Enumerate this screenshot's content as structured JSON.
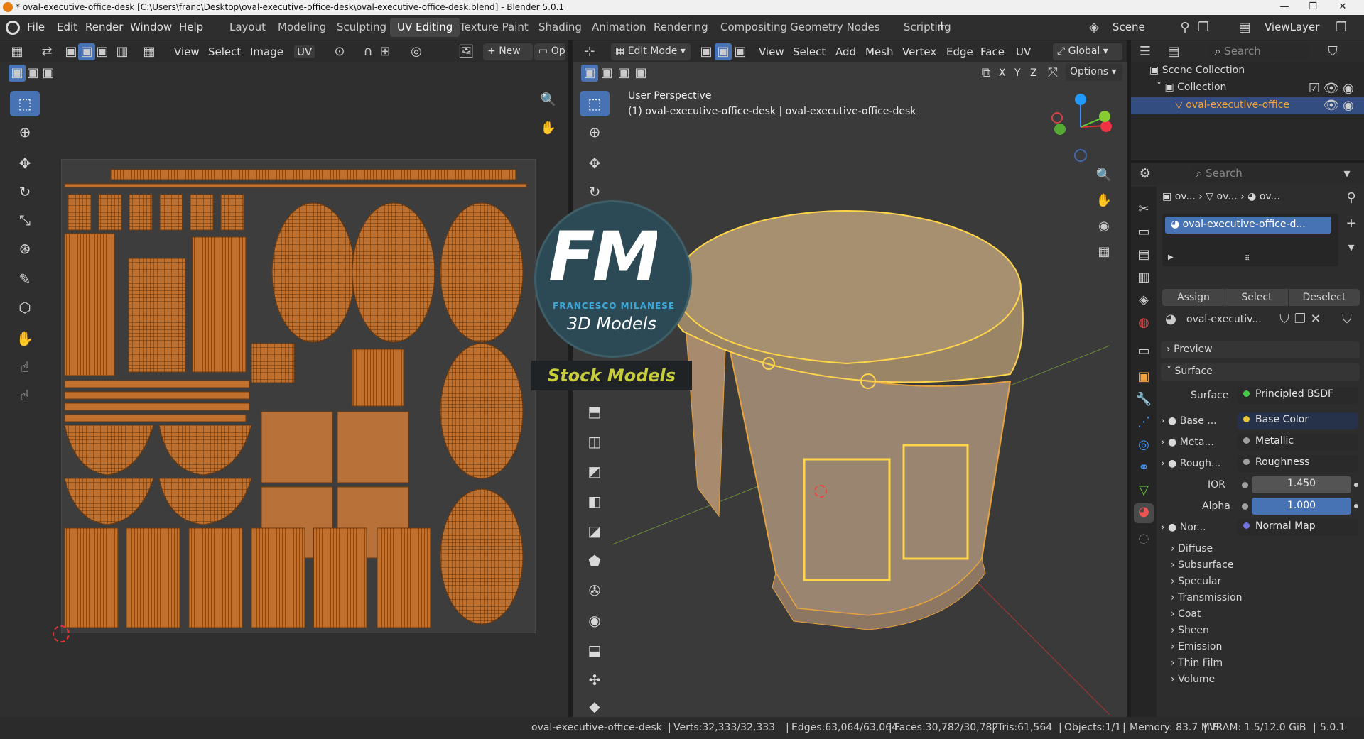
{
  "titlebar": {
    "title": "* oval-executive-office-desk [C:\\Users\\franc\\Desktop\\oval-executive-office-desk\\oval-executive-office-desk.blend] - Blender 5.0.1",
    "minimize": "—",
    "maximize": "❐",
    "close": "✕"
  },
  "menu": {
    "file": "File",
    "edit": "Edit",
    "render": "Render",
    "window": "Window",
    "help": "Help"
  },
  "workspaces": [
    "Layout",
    "Modeling",
    "Sculpting",
    "UV Editing",
    "Texture Paint",
    "Shading",
    "Animation",
    "Rendering",
    "Compositing",
    "Geometry Nodes",
    "Scripting"
  ],
  "workspace_add": "+",
  "scene": {
    "label": "Scene",
    "view_layer": "ViewLayer"
  },
  "uv_editor": {
    "view": "View",
    "select": "Select",
    "image": "Image",
    "uv": "UV",
    "new": "New",
    "open": "Op"
  },
  "viewport": {
    "mode": "Edit Mode",
    "view": "View",
    "select": "Select",
    "add": "Add",
    "mesh": "Mesh",
    "vertex": "Vertex",
    "edge": "Edge",
    "face": "Face",
    "uv": "UV",
    "orientation": "Global",
    "options": "Options",
    "x": "X",
    "y": "Y",
    "z": "Z",
    "perspective": "User Perspective",
    "object_info": "(1) oval-executive-office-desk | oval-executive-office-desk"
  },
  "watermark": {
    "logo": "FM",
    "brand": "FRANCESCO MILANESE",
    "sub": "3D Models",
    "banner": "Stock Models"
  },
  "outliner": {
    "search": "Search",
    "scene_collection": "Scene Collection",
    "collection": "Collection",
    "object": "oval-executive-office"
  },
  "properties": {
    "search": "Search",
    "crumbs": [
      "ov...",
      "ov...",
      "ov..."
    ],
    "material_slot": "oval-executive-office-d...",
    "assign": "Assign",
    "select": "Select",
    "deselect": "Deselect",
    "material_name": "oval-executiv...",
    "preview": "Preview",
    "surface_section": "Surface",
    "surface_label": "Surface",
    "surface_value": "Principled BSDF",
    "inputs": [
      {
        "label": "Base ...",
        "value": "Base Color",
        "color": "#e8c43a"
      },
      {
        "label": "Meta...",
        "value": "Metallic",
        "color": "#a0a0a0"
      },
      {
        "label": "Rough...",
        "value": "Roughness",
        "color": "#a0a0a0"
      }
    ],
    "ior_label": "IOR",
    "ior": "1.450",
    "alpha_label": "Alpha",
    "alpha": "1.000",
    "alpha_fill": 1.0,
    "normal_label": "Nor...",
    "normal_value": "Normal Map",
    "normal_color": "#6f6fe0",
    "subpanels": [
      "Diffuse",
      "Subsurface",
      "Specular",
      "Transmission",
      "Coat",
      "Sheen",
      "Emission",
      "Thin Film",
      "Volume"
    ]
  },
  "statusbar": {
    "object": "oval-executive-office-desk",
    "verts": "Verts:32,333/32,333",
    "edges": "Edges:63,064/63,064",
    "faces": "Faces:30,782/30,782",
    "tris": "Tris:61,564",
    "objects": "Objects:1/1",
    "memory": "Memory: 83.7 MiB",
    "vram": "VRAM: 1.5/12.0 GiB",
    "version": "5.0.1"
  },
  "colors": {
    "accent": "#4772b3",
    "mesh": "#e8a33c",
    "uv": "#c2702e",
    "selected_wire": "#ffd54a"
  }
}
